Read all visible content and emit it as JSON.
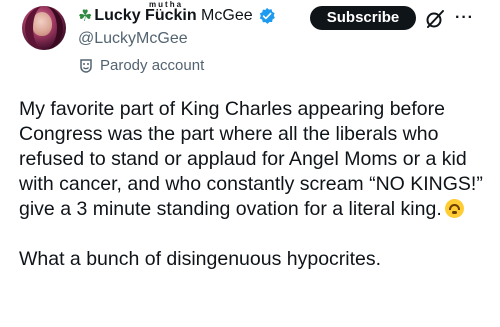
{
  "post": {
    "author": {
      "name_prefix": "Lucky ",
      "name_middle": "F",
      "name_middle_rest": "ckin",
      "name_overlay": "mutha",
      "name_suffix": " McGee",
      "handle": "@LuckyMcGee",
      "label": "Parody account",
      "verified": true
    },
    "subscribe_label": "Subscribe",
    "paragraphs": [
      "My favorite part of King Charles appearing before Congress was the part where all the liberals who refused to stand or applaud for Angel Moms or a kid with cancer, and who constantly scream “NO KINGS!” give a 3 minute standing ovation for a literal king.",
      "What a bunch of disingenuous hypocrites."
    ],
    "emoji": "upside-down-face"
  },
  "colors": {
    "text": "#0f1419",
    "muted": "#536471",
    "verified_blue": "#1d9bf0",
    "clover_green": "#2e8b3f",
    "subscribe_bg": "#0f1419"
  },
  "icons": [
    "clover-icon",
    "verified-badge-icon",
    "parody-mask-icon",
    "grok-icon",
    "more-icon"
  ]
}
